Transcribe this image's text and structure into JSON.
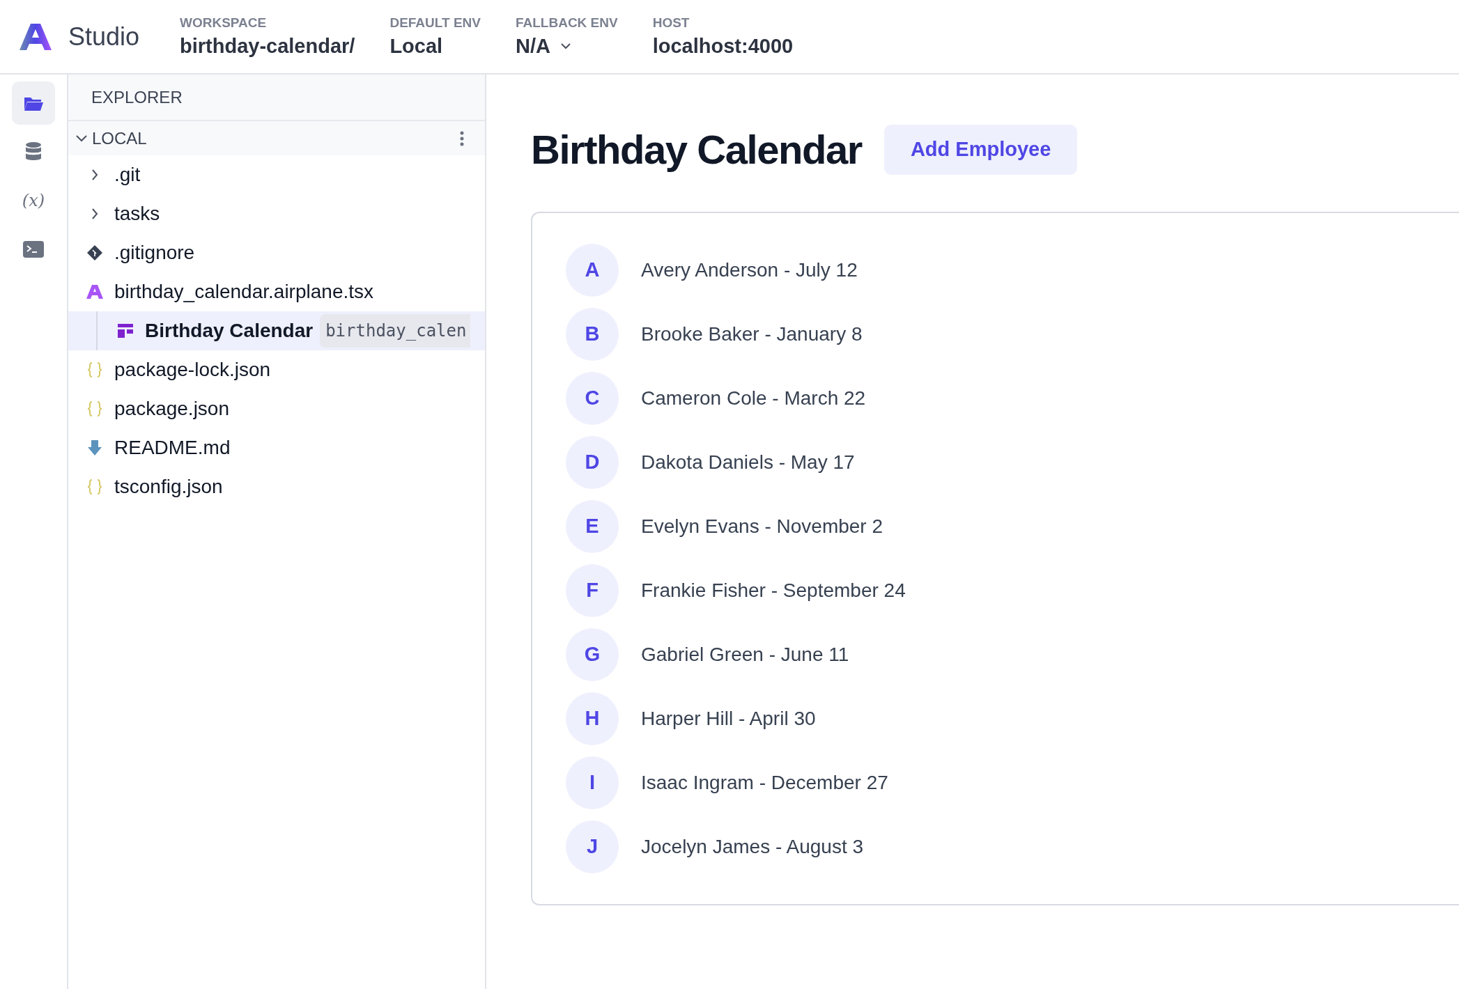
{
  "header": {
    "app_name": "Studio",
    "fields": [
      {
        "label": "WORKSPACE",
        "value": "birthday-calendar/",
        "dropdown": false
      },
      {
        "label": "DEFAULT ENV",
        "value": "Local",
        "dropdown": false
      },
      {
        "label": "FALLBACK ENV",
        "value": "N/A",
        "dropdown": true
      },
      {
        "label": "HOST",
        "value": "localhost:4000",
        "dropdown": false
      }
    ]
  },
  "rail": [
    {
      "kind": "files",
      "selected": true
    },
    {
      "kind": "database",
      "selected": false
    },
    {
      "kind": "variables",
      "selected": false,
      "glyph": "(x)"
    },
    {
      "kind": "terminal",
      "selected": false
    }
  ],
  "explorer": {
    "title": "EXPLORER",
    "section": {
      "label": "LOCAL",
      "expanded": true
    },
    "items": [
      {
        "kind": "folder",
        "name": ".git",
        "expanded": false,
        "selected": false
      },
      {
        "kind": "folder",
        "name": "tasks",
        "expanded": false,
        "selected": false
      },
      {
        "kind": "git",
        "name": ".gitignore",
        "selected": false
      },
      {
        "kind": "airplane",
        "name": "birthday_calendar.airplane.tsx",
        "selected": false,
        "children": [
          {
            "kind": "task",
            "name": "Birthday Calendar",
            "slug": "birthday_calen",
            "selected": true
          }
        ]
      },
      {
        "kind": "json",
        "name": "package-lock.json",
        "selected": false
      },
      {
        "kind": "json",
        "name": "package.json",
        "selected": false
      },
      {
        "kind": "markdown",
        "name": "README.md",
        "selected": false
      },
      {
        "kind": "json",
        "name": "tsconfig.json",
        "selected": false
      }
    ]
  },
  "main": {
    "title": "Birthday Calendar",
    "button": "Add Employee",
    "employees": [
      {
        "initial": "A",
        "text": "Avery Anderson - July 12"
      },
      {
        "initial": "B",
        "text": "Brooke Baker - January 8"
      },
      {
        "initial": "C",
        "text": "Cameron Cole - March 22"
      },
      {
        "initial": "D",
        "text": "Dakota Daniels - May 17"
      },
      {
        "initial": "E",
        "text": "Evelyn Evans - November 2"
      },
      {
        "initial": "F",
        "text": "Frankie Fisher - September 24"
      },
      {
        "initial": "G",
        "text": "Gabriel Green - June 11"
      },
      {
        "initial": "H",
        "text": "Harper Hill - April 30"
      },
      {
        "initial": "I",
        "text": "Isaac Ingram - December 27"
      },
      {
        "initial": "J",
        "text": "Jocelyn James - August 3"
      }
    ]
  }
}
